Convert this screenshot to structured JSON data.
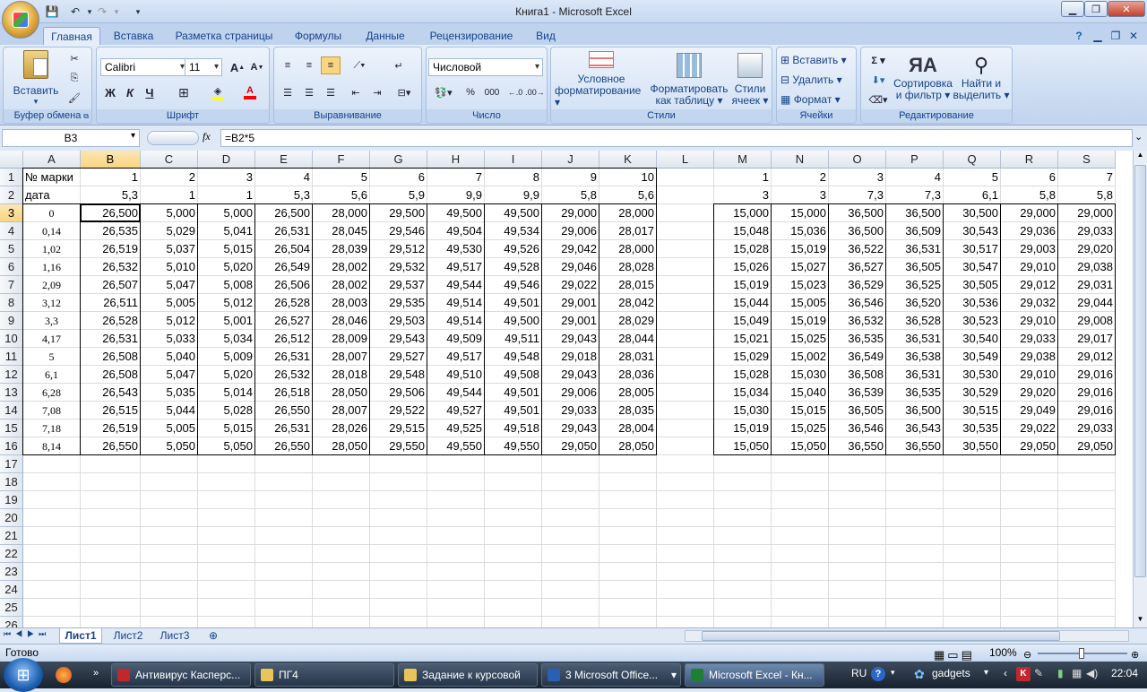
{
  "window": {
    "title": "Книга1 - Microsoft Excel"
  },
  "ribbon": {
    "tabs": [
      "Главная",
      "Вставка",
      "Разметка страницы",
      "Формулы",
      "Данные",
      "Рецензирование",
      "Вид"
    ],
    "clipboard": {
      "label": "Буфер обмена",
      "paste": "Вставить"
    },
    "font": {
      "label": "Шрифт",
      "name": "Calibri",
      "size": "11",
      "bold": "Ж",
      "italic": "К",
      "underline": "Ч"
    },
    "alignment": {
      "label": "Выравнивание"
    },
    "number": {
      "label": "Число",
      "format": "Числовой",
      "percent": "%",
      "thousands": "000"
    },
    "styles": {
      "label": "Стили",
      "conditional": [
        "Условное",
        "форматирование"
      ],
      "as_table": [
        "Форматировать",
        "как таблицу"
      ],
      "cell_styles": [
        "Стили",
        "ячеек"
      ]
    },
    "cells": {
      "label": "Ячейки",
      "insert": "Вставить",
      "delete": "Удалить",
      "format": "Формат"
    },
    "editing": {
      "label": "Редактирование",
      "sort": [
        "Сортировка",
        "и фильтр"
      ],
      "find": [
        "Найти и",
        "выделить"
      ]
    }
  },
  "formula_bar": {
    "name_box": "B3",
    "fx": "fx",
    "formula": "=B2*5"
  },
  "grid": {
    "columns": [
      "A",
      "B",
      "C",
      "D",
      "E",
      "F",
      "G",
      "H",
      "I",
      "J",
      "K",
      "L",
      "M",
      "N",
      "O",
      "P",
      "Q",
      "R",
      "S"
    ],
    "rows": [
      "1",
      "2",
      "3",
      "4",
      "5",
      "6",
      "7",
      "8",
      "9",
      "10",
      "11",
      "12",
      "13",
      "14",
      "15",
      "16",
      "17",
      "18",
      "19",
      "20",
      "21",
      "22",
      "23",
      "24",
      "25",
      "26"
    ],
    "header_row": [
      "№ марки",
      "1",
      "2",
      "3",
      "4",
      "5",
      "6",
      "7",
      "8",
      "9",
      "10",
      "",
      "1",
      "2",
      "3",
      "4",
      "5",
      "6",
      "7"
    ],
    "date_row": [
      "дата",
      "5,3",
      "1",
      "1",
      "5,3",
      "5,6",
      "5,9",
      "9,9",
      "9,9",
      "5,8",
      "5,6",
      "",
      "3",
      "3",
      "7,3",
      "7,3",
      "6,1",
      "5,8",
      "5,8"
    ],
    "data_rows": [
      [
        "0",
        "26,500",
        "5,000",
        "5,000",
        "26,500",
        "28,000",
        "29,500",
        "49,500",
        "49,500",
        "29,000",
        "28,000",
        "",
        "15,000",
        "15,000",
        "36,500",
        "36,500",
        "30,500",
        "29,000",
        "29,000"
      ],
      [
        "0,14",
        "26,535",
        "5,029",
        "5,041",
        "26,531",
        "28,045",
        "29,546",
        "49,504",
        "49,534",
        "29,006",
        "28,017",
        "",
        "15,048",
        "15,036",
        "36,500",
        "36,509",
        "30,543",
        "29,036",
        "29,033"
      ],
      [
        "1,02",
        "26,519",
        "5,037",
        "5,015",
        "26,504",
        "28,039",
        "29,512",
        "49,530",
        "49,526",
        "29,042",
        "28,000",
        "",
        "15,028",
        "15,019",
        "36,522",
        "36,531",
        "30,517",
        "29,003",
        "29,020"
      ],
      [
        "1,16",
        "26,532",
        "5,010",
        "5,020",
        "26,549",
        "28,002",
        "29,532",
        "49,517",
        "49,528",
        "29,046",
        "28,028",
        "",
        "15,026",
        "15,027",
        "36,527",
        "36,505",
        "30,547",
        "29,010",
        "29,038"
      ],
      [
        "2,09",
        "26,507",
        "5,047",
        "5,008",
        "26,506",
        "28,002",
        "29,537",
        "49,544",
        "49,546",
        "29,022",
        "28,015",
        "",
        "15,019",
        "15,023",
        "36,529",
        "36,525",
        "30,505",
        "29,012",
        "29,031"
      ],
      [
        "3,12",
        "26,511",
        "5,005",
        "5,012",
        "26,528",
        "28,003",
        "29,535",
        "49,514",
        "49,501",
        "29,001",
        "28,042",
        "",
        "15,044",
        "15,005",
        "36,546",
        "36,520",
        "30,536",
        "29,032",
        "29,044"
      ],
      [
        "3,3",
        "26,528",
        "5,012",
        "5,001",
        "26,527",
        "28,046",
        "29,503",
        "49,514",
        "49,500",
        "29,001",
        "28,029",
        "",
        "15,049",
        "15,019",
        "36,532",
        "36,528",
        "30,523",
        "29,010",
        "29,008"
      ],
      [
        "4,17",
        "26,531",
        "5,033",
        "5,034",
        "26,512",
        "28,009",
        "29,543",
        "49,509",
        "49,511",
        "29,043",
        "28,044",
        "",
        "15,021",
        "15,025",
        "36,535",
        "36,531",
        "30,540",
        "29,033",
        "29,017"
      ],
      [
        "5",
        "26,508",
        "5,040",
        "5,009",
        "26,531",
        "28,007",
        "29,527",
        "49,517",
        "49,548",
        "29,018",
        "28,031",
        "",
        "15,029",
        "15,002",
        "36,549",
        "36,538",
        "30,549",
        "29,038",
        "29,012"
      ],
      [
        "6,1",
        "26,508",
        "5,047",
        "5,020",
        "26,532",
        "28,018",
        "29,548",
        "49,510",
        "49,508",
        "29,043",
        "28,036",
        "",
        "15,028",
        "15,030",
        "36,508",
        "36,531",
        "30,530",
        "29,010",
        "29,016"
      ],
      [
        "6,28",
        "26,543",
        "5,035",
        "5,014",
        "26,518",
        "28,050",
        "29,506",
        "49,544",
        "49,501",
        "29,006",
        "28,005",
        "",
        "15,034",
        "15,040",
        "36,539",
        "36,535",
        "30,529",
        "29,020",
        "29,016"
      ],
      [
        "7,08",
        "26,515",
        "5,044",
        "5,028",
        "26,550",
        "28,007",
        "29,522",
        "49,527",
        "49,501",
        "29,033",
        "28,035",
        "",
        "15,030",
        "15,015",
        "36,505",
        "36,500",
        "30,515",
        "29,049",
        "29,016"
      ],
      [
        "7,18",
        "26,519",
        "5,005",
        "5,015",
        "26,531",
        "28,026",
        "29,515",
        "49,525",
        "49,518",
        "29,043",
        "28,004",
        "",
        "15,019",
        "15,025",
        "36,546",
        "36,543",
        "30,535",
        "29,022",
        "29,033"
      ],
      [
        "8,14",
        "26,550",
        "5,050",
        "5,050",
        "26,550",
        "28,050",
        "29,550",
        "49,550",
        "49,550",
        "29,050",
        "28,050",
        "",
        "15,050",
        "15,050",
        "36,550",
        "36,550",
        "30,550",
        "29,050",
        "29,050"
      ]
    ]
  },
  "sheets": [
    "Лист1",
    "Лист2",
    "Лист3"
  ],
  "status": {
    "ready": "Готово",
    "zoom": "100%"
  },
  "taskbar": {
    "items": [
      "Антивирус Касперс...",
      "ПГ4",
      "Задание к курсовой",
      "3 Microsoft Office...",
      "Microsoft Excel - Кн..."
    ],
    "lang": "RU",
    "gadgets": "gadgets",
    "clock": "22:04"
  },
  "colors": {
    "accent": "#15428b",
    "selected_header": "#f8d57f",
    "ribbon_bg": "#dfe8f5"
  }
}
